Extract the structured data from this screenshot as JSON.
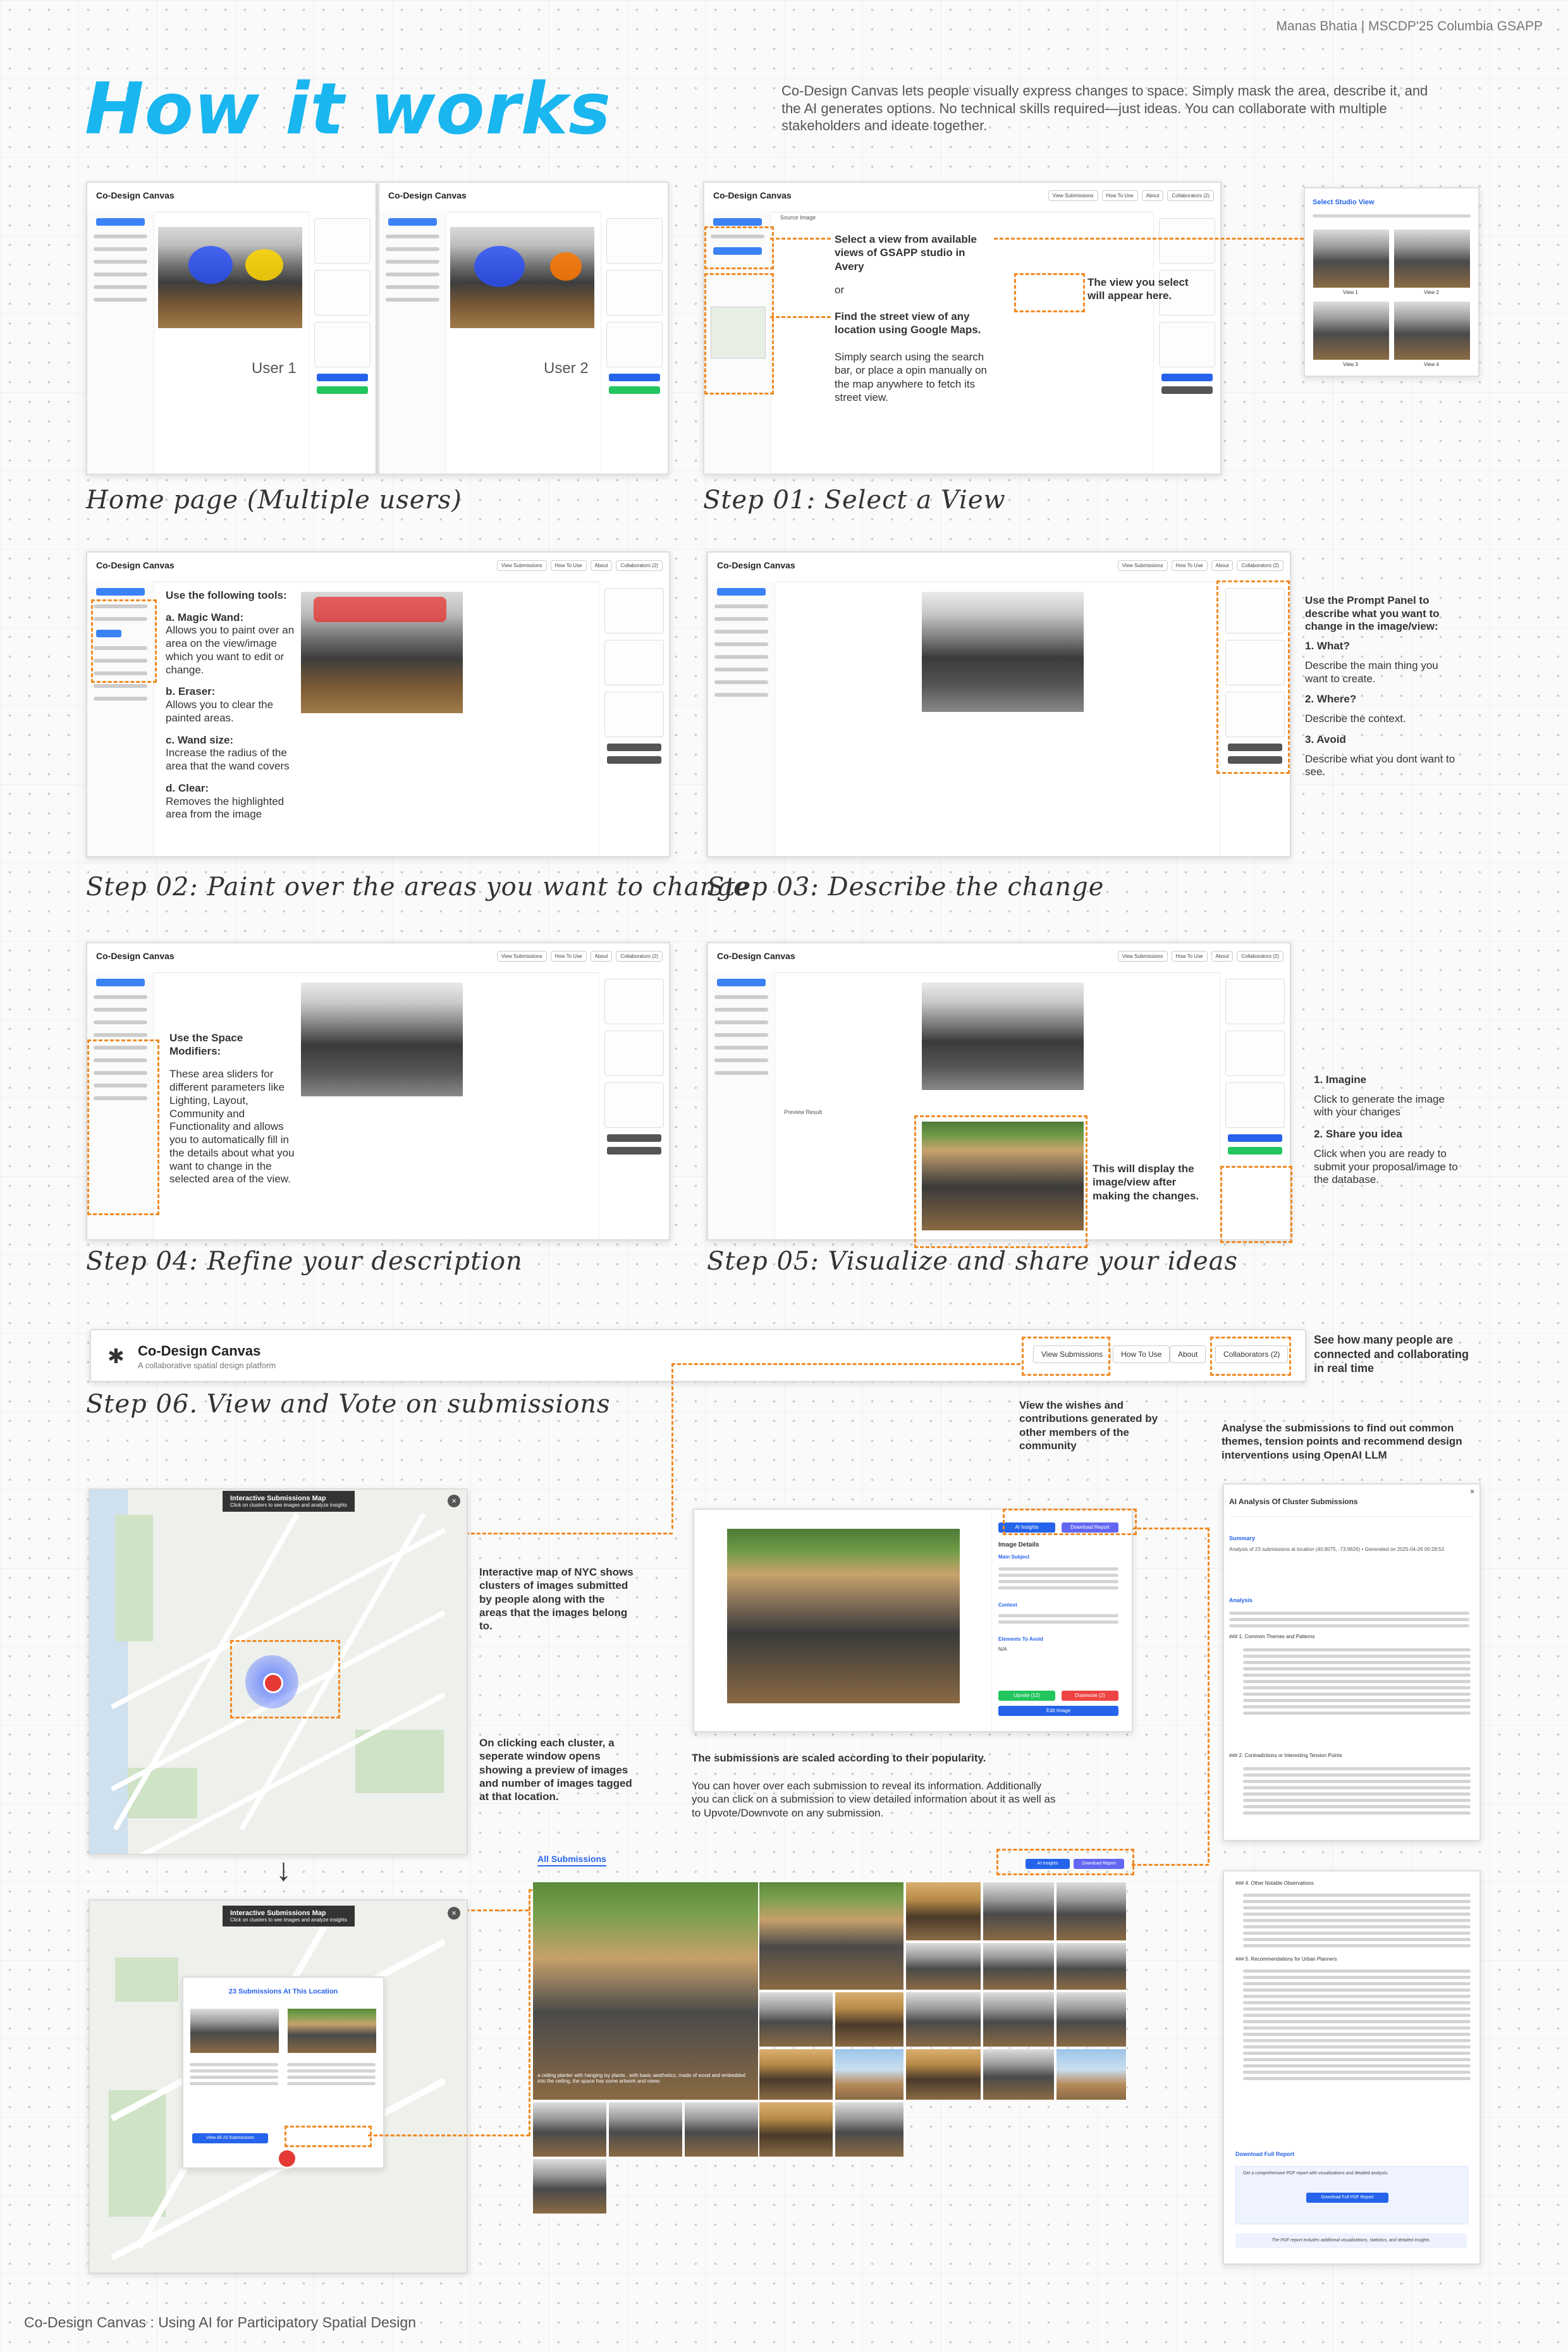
{
  "credit": "Manas Bhatia | MSCDP'25 Columbia GSAPP",
  "title": "How it works",
  "intro": "Co-Design Canvas lets people visually express changes to space. Simply mask the area, describe it, and the AI generates options. No technical skills required—just ideas. You can collaborate with multiple stakeholders and ideate together.",
  "footer": "Co-Design Canvas : Using AI for Participatory Spatial Design",
  "app": {
    "name": "Co-Design Canvas",
    "tagline": "A collaborative spatial design platform",
    "nav": [
      "View Submissions",
      "How To Use",
      "About",
      "Collaborators (2)"
    ],
    "source_image": "Source Image",
    "preview_result": "Preview Result",
    "describe_change": "Describe The Change",
    "imagine": "Imagine",
    "share": "Share Your Idea"
  },
  "home": {
    "caption": "Home page (Multiple users)",
    "user1": "User 1",
    "user2": "User 2"
  },
  "step1": {
    "caption": "Step 01: Select a View",
    "note_a": "Select a view from available views of GSAPP studio in Avery",
    "or": "or",
    "note_b": "Find the street view of any location using Google Maps.",
    "note_c": "Simply search using the search bar, or place a opin manually on the map anywhere to fetch its street view.",
    "note_d": "The view you select will appear here.",
    "modal_title": "Select Studio View",
    "views": [
      "View 1",
      "View 2",
      "View 3",
      "View 4"
    ]
  },
  "step2": {
    "caption": "Step 02: Paint over the areas you want to change",
    "heading": "Use the following tools:",
    "a_title": "a. Magic Wand:",
    "a_text": "Allows you to paint over an area on the view/image which you want to edit or change.",
    "b_title": "b. Eraser:",
    "b_text": "Allows you to clear the painted areas.",
    "c_title": "c. Wand size:",
    "c_text": "Increase the radius of the area that the wand covers",
    "d_title": "d. Clear:",
    "d_text": "Removes the highlighted area from the image"
  },
  "step3": {
    "caption": "Step 03: Describe the change",
    "intro": "Use the Prompt Panel to describe what you want to change in the image/view:",
    "q1": "1. What?",
    "q1_text": "Describe the main thing you want to create.",
    "q2": "2. Where?",
    "q2_text": "Describe the context.",
    "q3": "3. Avoid",
    "q3_text": "Describe what you dont want to see."
  },
  "step4": {
    "caption": "Step 04: Refine your description",
    "heading": "Use the Space Modifiers:",
    "text": "These area sliders for different parameters like Lighting, Layout, Community and Functionality and allows you to automatically fill in the details about what you want to change in the selected area of the view."
  },
  "step5": {
    "caption": "Step 05: Visualize and share your ideas",
    "display_note": "This will display the image/view after making the changes.",
    "i1": "1. Imagine",
    "i1_text": "Click to generate the image with your changes",
    "i2": "2. Share you idea",
    "i2_text": "Click when you are ready to submit your proposal/image to the database."
  },
  "step6": {
    "caption": "Step 06. View and Vote on submissions",
    "collab_note": "See how many people are connected and collaborating in real time",
    "view_note": "View the wishes and contributions generated by other members of the community",
    "analyse_note": "Analyse the submissions to find out common themes, tension points and recommend design interventions using OpenAI LLM",
    "map_note": "Interactive map of NYC shows clusters of images submitted by people along with the areas that the images belong to.",
    "cluster_note": "On clicking each cluster, a seperate window opens showing a preview of images and number of images tagged at that location.",
    "scale_note": "The submissions are scaled according to their popularity.",
    "hover_note": "You can hover over each submission to reveal its information. Additionally you can click on a submission to view detailed information about it as well as to Upvote/Downvote on any submission.",
    "map_title": "Interactive Submissions Map",
    "map_sub": "Click on clusters to see images and analyze insights",
    "cluster_title": "23 Submissions At This Location",
    "cluster_btn": "View All 23 Submissions",
    "all_submissions": "All Submissions",
    "ai_insights": "AI Insights",
    "download_report": "Download Report",
    "image_details": "Image Details",
    "main_subject": "Main Subject",
    "context": "Context",
    "elements_avoid": "Elements To Avoid",
    "avoid_value": "N/A",
    "upvote": "Upvote (12)",
    "downvote": "Downvote (2)",
    "edit_image": "Edit Image",
    "hover_caption": "a ceiling planter with hanging ivy plants , with basic aesthetics, made of wood and embedded into the ceiling, the space has some artwork and views",
    "ai_title": "AI Analysis Of Cluster Submissions",
    "summary": "Summary",
    "summary_text": "Analysis of 23 submissions at location (40.8075, -73.9626) • Generated on 2025-04-26 00:28:53",
    "analysis": "Analysis",
    "h1": "### 1. Common Themes and Patterns",
    "h2": "### 2. Contradictions or Interesting Tension Points",
    "h4": "### 4. Other Notable Observations",
    "h5": "### 5. Recommendations for Urban Planners",
    "full_report": "Download Full Report",
    "full_report_sub": "Get a comprehensive PDF report with visualizations and detailed analysis.",
    "pdf_btn": "Download Full PDF Report",
    "pdf_note": "The PDF report includes additional visualizations, statistics, and detailed insights."
  }
}
